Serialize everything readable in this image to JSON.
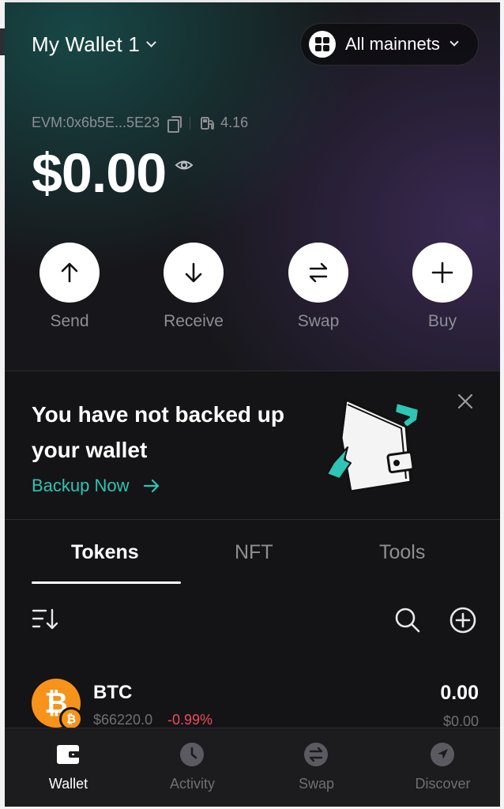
{
  "header": {
    "wallet_name": "My Wallet 1",
    "network_label": "All mainnets"
  },
  "account": {
    "address": "EVM:0x6b5E...5E23",
    "gas": "4.16",
    "balance": "$0.00"
  },
  "actions": [
    {
      "label": "Send",
      "icon": "arrow-up-icon"
    },
    {
      "label": "Receive",
      "icon": "arrow-down-icon"
    },
    {
      "label": "Swap",
      "icon": "swap-icon"
    },
    {
      "label": "Buy",
      "icon": "plus-icon"
    }
  ],
  "backup_banner": {
    "title": "You have not backed up your wallet",
    "link_label": "Backup Now"
  },
  "tabs": [
    {
      "label": "Tokens",
      "active": true
    },
    {
      "label": "NFT",
      "active": false
    },
    {
      "label": "Tools",
      "active": false
    }
  ],
  "tokens": [
    {
      "symbol": "BTC",
      "price": "$66220.0",
      "change": "-0.99%",
      "amount": "0.00",
      "value": "$0.00",
      "color": "#f7931a"
    }
  ],
  "bottom_nav": [
    {
      "label": "Wallet",
      "icon": "wallet-icon",
      "active": true
    },
    {
      "label": "Activity",
      "icon": "clock-icon",
      "active": false
    },
    {
      "label": "Swap",
      "icon": "swap-icon",
      "active": false
    },
    {
      "label": "Discover",
      "icon": "compass-icon",
      "active": false
    }
  ],
  "colors": {
    "accent": "#2ec4b6",
    "negative": "#ee4c5a",
    "background": "#141416"
  }
}
